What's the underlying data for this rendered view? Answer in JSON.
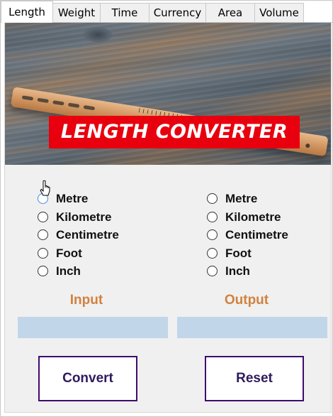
{
  "tabs": [
    {
      "label": "Length",
      "active": true
    },
    {
      "label": "Weight",
      "active": false
    },
    {
      "label": "Time",
      "active": false
    },
    {
      "label": "Currency",
      "active": false
    },
    {
      "label": "Area",
      "active": false
    },
    {
      "label": "Volume",
      "active": false
    }
  ],
  "banner": {
    "title": "LENGTH CONVERTER"
  },
  "input_units": [
    "Metre",
    "Kilometre",
    "Centimetre",
    "Foot",
    "Inch"
  ],
  "output_units": [
    "Metre",
    "Kilometre",
    "Centimetre",
    "Foot",
    "Inch"
  ],
  "labels": {
    "input": "Input",
    "output": "Output"
  },
  "fields": {
    "input_value": "",
    "output_value": ""
  },
  "buttons": {
    "convert": "Convert",
    "reset": "Reset"
  },
  "colors": {
    "title_background": "#e8000e",
    "section_label": "#d2813e",
    "field_background": "#c2d6ea",
    "button_border": "#3f0b6d",
    "panel_background": "#f0f0f0"
  }
}
